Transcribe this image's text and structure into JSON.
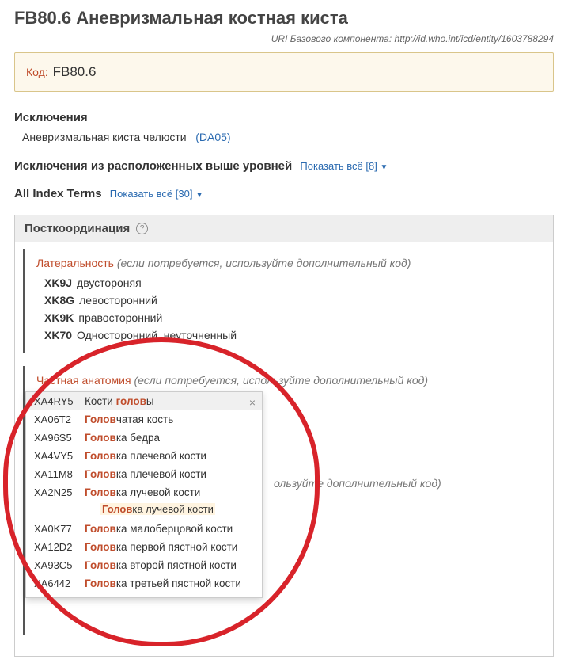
{
  "header": {
    "title": "FB80.6 Аневризмальная костная киста",
    "uri_label": "URI Базового компонента:",
    "uri_value": "http://id.who.int/icd/entity/1603788294"
  },
  "code_box": {
    "label": "Код:",
    "value": "FB80.6"
  },
  "exclusions": {
    "heading": "Исключения",
    "item_text": "Аневризмальная киста челюсти",
    "item_code": "(DA05)"
  },
  "excl_higher": {
    "heading": "Исключения из расположенных выше уровней",
    "show_all": "Показать всё [8]"
  },
  "index_terms": {
    "heading": "All Index Terms",
    "show_all": "Показать всё [30]"
  },
  "postcoord": {
    "heading": "Посткоординация",
    "laterality": {
      "name": "Латеральность",
      "hint": "(если потребуется, используйте дополнительный код)",
      "codes": [
        {
          "code": "XK9J",
          "label": "двустороняя"
        },
        {
          "code": "XK8G",
          "label": "левосторонний"
        },
        {
          "code": "XK9K",
          "label": "правосторонний"
        },
        {
          "code": "XK70",
          "label": "Односторонний, неуточненный"
        }
      ]
    },
    "anatomy": {
      "name": "Частная анатомия",
      "hint": "(если потребуется, используйте дополнительный код)",
      "search_value": "голов",
      "behind_hint": "ользуйте дополнительный код)"
    },
    "dropdown": {
      "items": [
        {
          "code": "XA4RY5",
          "pre": "Кости ",
          "match": "голов",
          "post": "ы",
          "hl": true,
          "close": true
        },
        {
          "code": "XA06T2",
          "pre": "",
          "match": "Голов",
          "post": "чатая кость"
        },
        {
          "code": "XA96S5",
          "pre": "",
          "match": "Голов",
          "post": "ка бедра"
        },
        {
          "code": "XA4VY5",
          "pre": "",
          "match": "Голов",
          "post": "ка плечевой кости"
        },
        {
          "code": "XA11M8",
          "pre": "",
          "match": "Голов",
          "post": "ка плечевой кости"
        },
        {
          "code": "XA2N25",
          "pre": "",
          "match": "Голов",
          "post": "ка лучевой кости",
          "sub": {
            "match": "Голов",
            "post": "ка лучевой кости"
          }
        },
        {
          "code": "XA0K77",
          "pre": "",
          "match": "Голов",
          "post": "ка малоберцовой кости"
        },
        {
          "code": "XA12D2",
          "pre": "",
          "match": "Голов",
          "post": "ка первой пястной кости"
        },
        {
          "code": "XA93C5",
          "pre": "",
          "match": "Голов",
          "post": "ка второй пястной кости"
        },
        {
          "code": "XA6442",
          "pre": "",
          "match": "Голов",
          "post": "ка третьей пястной кости"
        }
      ]
    }
  }
}
